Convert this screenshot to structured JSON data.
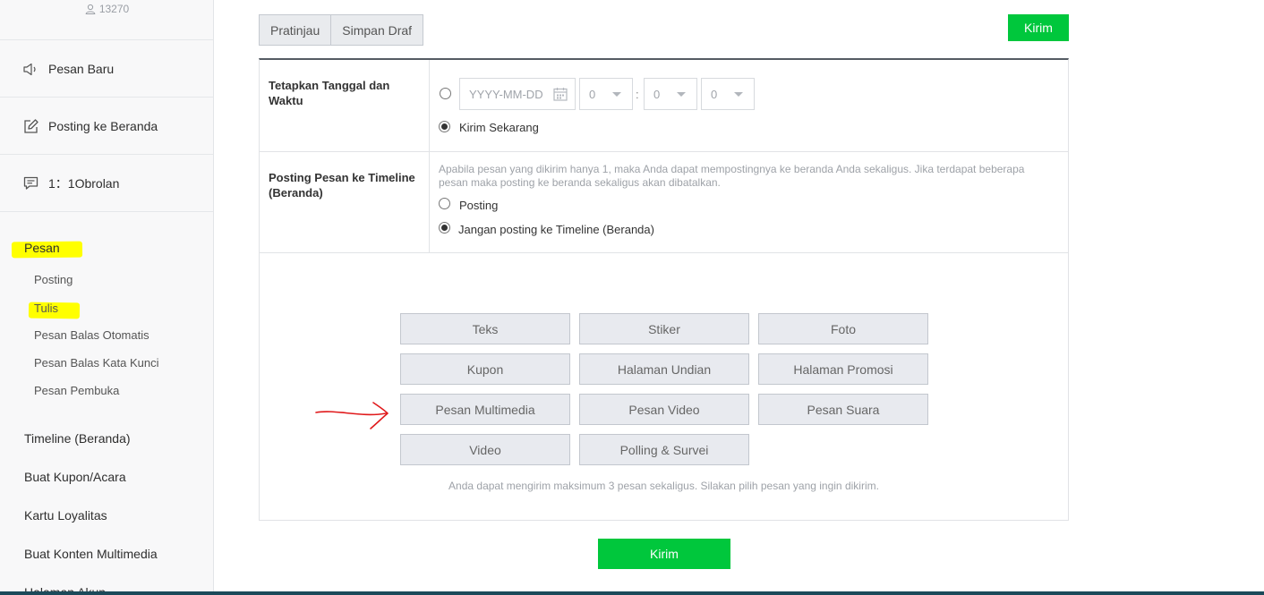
{
  "sidebar": {
    "follower_count": "13270",
    "nav": [
      {
        "label": "Pesan Baru",
        "icon": "megaphone-icon"
      },
      {
        "label": "Posting ke Beranda",
        "icon": "edit-icon"
      },
      {
        "label": "1：1Obrolan",
        "icon": "chat-icon"
      }
    ],
    "section": "Pesan",
    "sub_items": [
      "Posting",
      "Tulis",
      "Pesan Balas Otomatis",
      "Pesan Balas Kata Kunci",
      "Pesan Pembuka"
    ],
    "main_items": [
      "Timeline (Beranda)",
      "Buat Kupon/Acara",
      "Kartu Loyalitas",
      "Buat Konten Multimedia",
      "Halaman Akun"
    ]
  },
  "toolbar": {
    "preview": "Pratinjau",
    "save_draft": "Simpan Draf",
    "send": "Kirim"
  },
  "schedule": {
    "label": "Tetapkan Tanggal dan Waktu",
    "date_placeholder": "YYYY-MM-DD",
    "hour": "0",
    "minute": "0",
    "second": "0",
    "colon": ":",
    "send_now": "Kirim Sekarang",
    "selected": "send_now"
  },
  "timeline": {
    "label": "Posting Pesan ke Timeline (Beranda)",
    "note": "Apabila pesan yang dikirim hanya 1, maka Anda dapat mempostingnya ke beranda Anda sekaligus. Jika terdapat beberapa pesan maka posting ke beranda sekaligus akan dibatalkan.",
    "option_post": "Posting",
    "option_no_post": "Jangan posting ke Timeline (Beranda)",
    "selected": "no_post"
  },
  "message_types": [
    "Teks",
    "Stiker",
    "Foto",
    "Kupon",
    "Halaman Undian",
    "Halaman Promosi",
    "Pesan Multimedia",
    "Pesan Video",
    "Pesan Suara",
    "Video",
    "Polling & Survei"
  ],
  "message_note": "Anda dapat mengirim maksimum 3 pesan sekaligus. Silakan pilih pesan yang ingin dikirim.",
  "send_bottom": "Kirim",
  "colors": {
    "accent": "#00c73c",
    "highlight": "#ffff00",
    "annotation": "#e0191b"
  }
}
